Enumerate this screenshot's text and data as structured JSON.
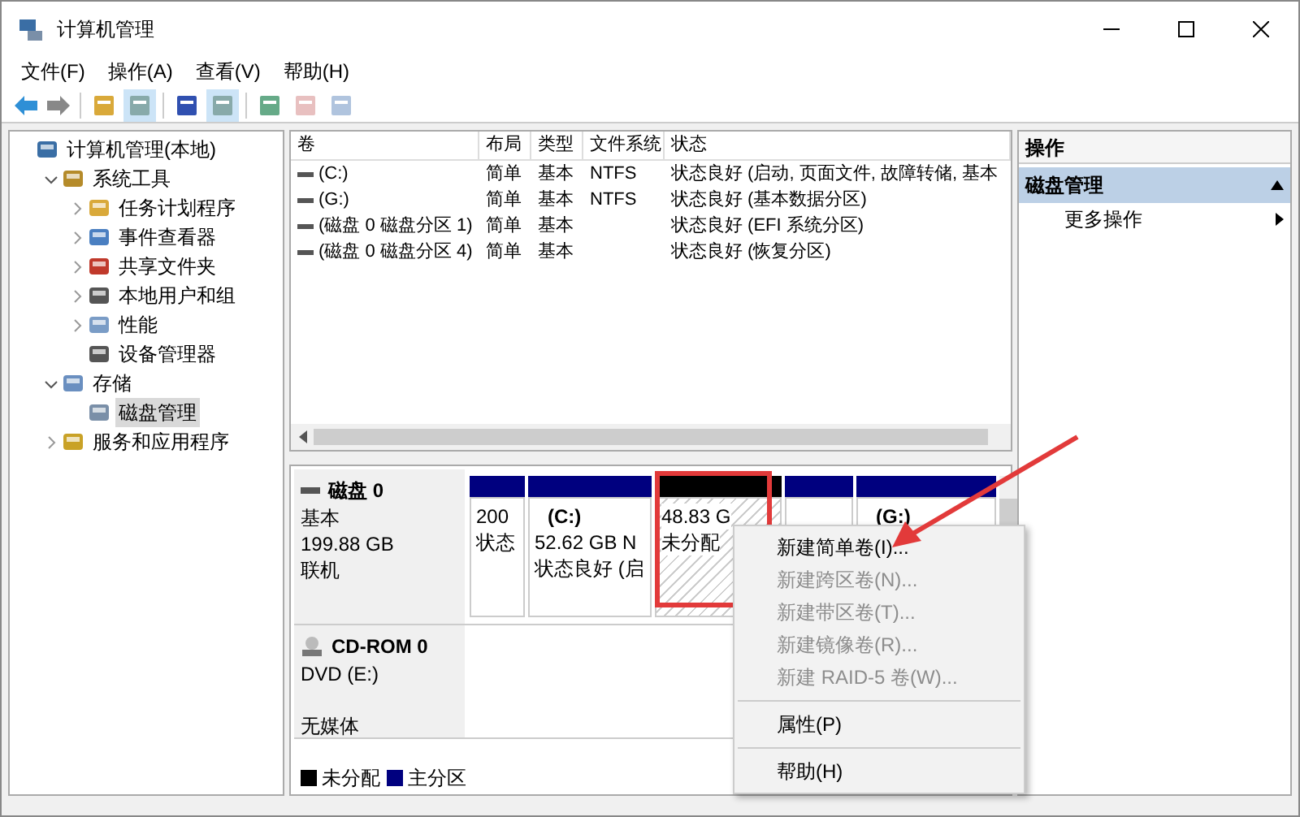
{
  "window": {
    "title": "计算机管理"
  },
  "menu": [
    "文件(F)",
    "操作(A)",
    "查看(V)",
    "帮助(H)"
  ],
  "tree": [
    {
      "label": "计算机管理(本地)",
      "selected": false,
      "children": [
        {
          "label": "系统工具",
          "expanded": true,
          "selected": false,
          "children": [
            {
              "label": "任务计划程序",
              "expanded": false,
              "selected": false
            },
            {
              "label": "事件查看器",
              "expanded": false,
              "selected": false
            },
            {
              "label": "共享文件夹",
              "expanded": false,
              "selected": false
            },
            {
              "label": "本地用户和组",
              "expanded": false,
              "selected": false
            },
            {
              "label": "性能",
              "expanded": false,
              "selected": false
            },
            {
              "label": "设备管理器",
              "selected": false
            }
          ]
        },
        {
          "label": "存储",
          "expanded": true,
          "selected": false,
          "children": [
            {
              "label": "磁盘管理",
              "selected": true
            }
          ]
        },
        {
          "label": "服务和应用程序",
          "expanded": false,
          "selected": false
        }
      ]
    }
  ],
  "table": {
    "columns": [
      "卷",
      "布局",
      "类型",
      "文件系统",
      "状态"
    ],
    "rows": [
      {
        "volume": "(C:)",
        "layout": "简单",
        "type": "基本",
        "filesystem": "NTFS",
        "status": "状态良好 (启动, 页面文件, 故障转储, 基本"
      },
      {
        "volume": "(G:)",
        "layout": "简单",
        "type": "基本",
        "filesystem": "NTFS",
        "status": "状态良好 (基本数据分区)"
      },
      {
        "volume": "(磁盘 0 磁盘分区 1)",
        "layout": "简单",
        "type": "基本",
        "status": "状态良好 (EFI 系统分区)"
      },
      {
        "volume": "(磁盘 0 磁盘分区 4)",
        "layout": "简单",
        "type": "基本",
        "status": "状态良好 (恢复分区)"
      }
    ]
  },
  "disks": [
    {
      "name": "磁盘 0",
      "kind": "hdd",
      "lines": [
        "基本",
        "199.88 GB",
        "联机"
      ],
      "partitions": [
        {
          "kind": "primary",
          "highlighted": false,
          "lines": [
            "200",
            "状态"
          ]
        },
        {
          "kind": "primary",
          "highlighted": false,
          "title": "(C:)",
          "lines": [
            "52.62 GB N",
            "状态良好 (启"
          ]
        },
        {
          "kind": "unallocated",
          "highlighted": true,
          "lines": [
            "48.83 G",
            "未分配"
          ]
        },
        {
          "kind": "primary",
          "highlighted": false
        },
        {
          "kind": "primary",
          "highlighted": false,
          "title": "(G:)"
        }
      ]
    },
    {
      "name": "CD-ROM 0",
      "kind": "cdrom",
      "lines": [
        "DVD (E:)",
        "无媒体"
      ]
    }
  ],
  "legend": [
    {
      "label": "未分配",
      "kind": "unallocated"
    },
    {
      "label": "主分区",
      "kind": "primary"
    }
  ],
  "actions": {
    "title": "操作",
    "section": "磁盘管理",
    "items": [
      "更多操作"
    ]
  },
  "context_menu": [
    {
      "kind": "item",
      "label": "新建简单卷(I)...",
      "disabled": false
    },
    {
      "kind": "item",
      "label": "新建跨区卷(N)...",
      "disabled": true
    },
    {
      "kind": "item",
      "label": "新建带区卷(T)...",
      "disabled": true
    },
    {
      "kind": "item",
      "label": "新建镜像卷(R)...",
      "disabled": true
    },
    {
      "kind": "item",
      "label": "新建 RAID-5 卷(W)...",
      "disabled": true
    },
    {
      "kind": "separator"
    },
    {
      "kind": "item",
      "label": "属性(P)",
      "disabled": false
    },
    {
      "kind": "separator"
    },
    {
      "kind": "item",
      "label": "帮助(H)",
      "disabled": false
    }
  ]
}
